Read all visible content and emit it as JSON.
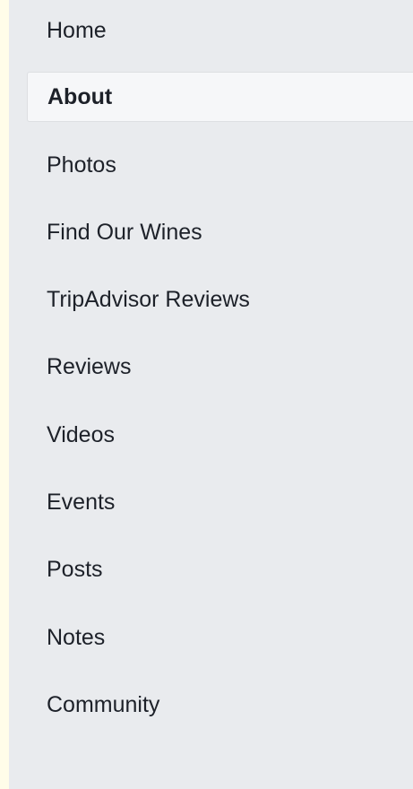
{
  "page_nav": {
    "active_item": "About",
    "items": [
      {
        "label": "Home"
      },
      {
        "label": "About"
      },
      {
        "label": "Photos"
      },
      {
        "label": "Find Our Wines"
      },
      {
        "label": "TripAdvisor Reviews"
      },
      {
        "label": "Reviews"
      },
      {
        "label": "Videos"
      },
      {
        "label": "Events"
      },
      {
        "label": "Posts"
      },
      {
        "label": "Notes"
      },
      {
        "label": "Community"
      }
    ]
  },
  "colors": {
    "nav_background": "#e9ebee",
    "active_background": "#f6f7f9",
    "text": "#1d2129",
    "outer_background": "#fffde9"
  }
}
